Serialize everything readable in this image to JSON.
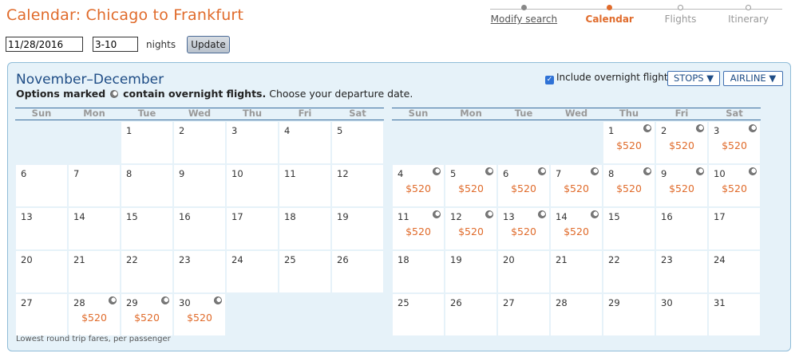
{
  "page_title": "Calendar: Chicago to Frankfurt",
  "progress": {
    "steps": [
      {
        "label": "Modify search",
        "state": "link"
      },
      {
        "label": "Calendar",
        "state": "active"
      },
      {
        "label": "Flights",
        "state": "todo"
      },
      {
        "label": "Itinerary",
        "state": "todo"
      }
    ]
  },
  "search": {
    "date_value": "11/28/2016",
    "nights_value": "3-10",
    "nights_label": "nights",
    "update_label": "Update"
  },
  "panel": {
    "title": "November–December",
    "subtitle_bold_1": "Options marked",
    "subtitle_bold_2": "contain overnight flights.",
    "subtitle_rest": "Choose your departure date.",
    "overnight_label": "Include overnight flights",
    "overnight_checked": true,
    "stops_label": "STOPS ▼",
    "airline_label": "AIRLINE ▼",
    "legend": "Lowest round trip fares, per passenger"
  },
  "colors": {
    "accent": "#e06b2b",
    "brand": "#1f4d86",
    "panel_bg": "#e6f2f9"
  },
  "weekdays": [
    "Sun",
    "Mon",
    "Tue",
    "Wed",
    "Thu",
    "Fri",
    "Sat"
  ],
  "months": [
    {
      "name": "November",
      "first_weekday": 2,
      "days": 30,
      "fares": {
        "28": {
          "price": "$520",
          "overnight": true
        },
        "29": {
          "price": "$520",
          "overnight": true
        },
        "30": {
          "price": "$520",
          "overnight": true
        }
      }
    },
    {
      "name": "December",
      "first_weekday": 4,
      "days": 31,
      "fares": {
        "1": {
          "price": "$520",
          "overnight": true
        },
        "2": {
          "price": "$520",
          "overnight": true
        },
        "3": {
          "price": "$520",
          "overnight": true
        },
        "4": {
          "price": "$520",
          "overnight": true
        },
        "5": {
          "price": "$520",
          "overnight": true
        },
        "6": {
          "price": "$520",
          "overnight": true
        },
        "7": {
          "price": "$520",
          "overnight": true
        },
        "8": {
          "price": "$520",
          "overnight": true
        },
        "9": {
          "price": "$520",
          "overnight": true
        },
        "10": {
          "price": "$520",
          "overnight": true
        },
        "11": {
          "price": "$520",
          "overnight": true
        },
        "12": {
          "price": "$520",
          "overnight": true
        },
        "13": {
          "price": "$520",
          "overnight": true
        },
        "14": {
          "price": "$520",
          "overnight": true
        }
      }
    }
  ]
}
